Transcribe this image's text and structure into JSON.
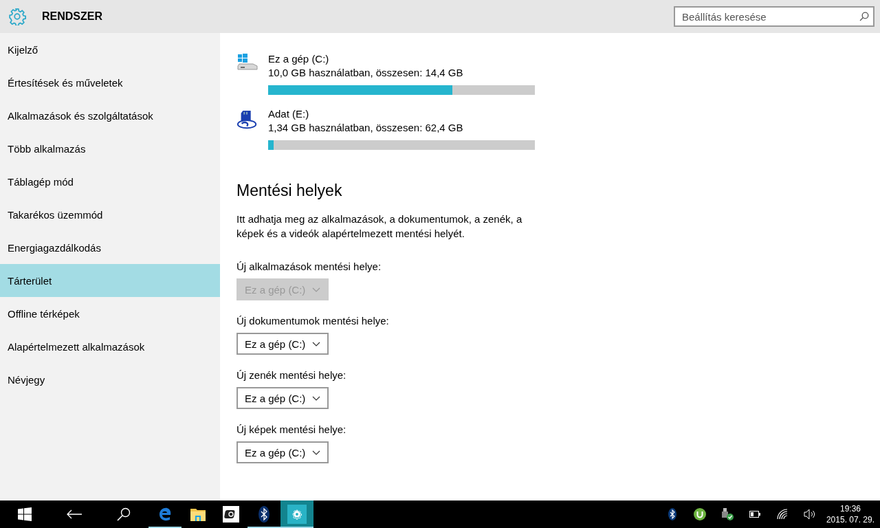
{
  "header": {
    "title": "RENDSZER",
    "search": {
      "placeholder": "Beállítás keresése"
    }
  },
  "sidebar": {
    "items": [
      {
        "label": "Kijelző",
        "selected": false
      },
      {
        "label": "Értesítések és műveletek",
        "selected": false
      },
      {
        "label": "Alkalmazások és szolgáltatások",
        "selected": false
      },
      {
        "label": "Több alkalmazás",
        "selected": false
      },
      {
        "label": "Táblagép mód",
        "selected": false
      },
      {
        "label": "Takarékos üzemmód",
        "selected": false
      },
      {
        "label": "Energiagazdálkodás",
        "selected": false
      },
      {
        "label": "Tárterület",
        "selected": true
      },
      {
        "label": "Offline térképek",
        "selected": false
      },
      {
        "label": "Alapértelmezett alkalmazások",
        "selected": false
      },
      {
        "label": "Névjegy",
        "selected": false
      }
    ]
  },
  "content": {
    "drives": [
      {
        "kind": "system",
        "name": "Ez a gép (C:)",
        "usage": "10,0 GB használatban, összesen: 14,4 GB",
        "level": 0.69
      },
      {
        "kind": "sdcard",
        "name": "Adat (E:)",
        "usage": "1,34 GB használatban, összesen: 62,4 GB",
        "level": 0.02
      }
    ],
    "save_locations": {
      "heading": "Mentési helyek",
      "description": "Itt adhatja meg az alkalmazások, a dokumentumok, a zenék, a képek és a videók alapértelmezett mentési helyét.",
      "settings": [
        {
          "label": "Új alkalmazások mentési helye:",
          "value": "Ez a gép (C:)",
          "disabled": true
        },
        {
          "label": "Új dokumentumok mentési helye:",
          "value": "Ez a gép (C:)",
          "disabled": false
        },
        {
          "label": "Új zenék mentési helye:",
          "value": "Ez a gép (C:)",
          "disabled": false
        },
        {
          "label": "Új képek mentési helye:",
          "value": "Ez a gép (C:)",
          "disabled": false
        }
      ]
    }
  },
  "taskbar": {
    "apps": [
      {
        "kind": "start",
        "running": false,
        "selected": false
      },
      {
        "kind": "back",
        "running": false,
        "selected": false
      },
      {
        "kind": "search",
        "running": false,
        "selected": false
      },
      {
        "kind": "edge",
        "running": true,
        "selected": false
      },
      {
        "kind": "explorer",
        "running": false,
        "selected": false
      },
      {
        "kind": "app",
        "running": false,
        "selected": false
      },
      {
        "kind": "bluetooth",
        "running": true,
        "selected": false
      },
      {
        "kind": "settings",
        "running": true,
        "selected": true
      }
    ],
    "tray": [
      {
        "kind": "bluetooth"
      },
      {
        "kind": "torrent"
      },
      {
        "kind": "usb"
      },
      {
        "kind": "battery"
      },
      {
        "kind": "wifi"
      },
      {
        "kind": "volume"
      }
    ],
    "time": "19:36",
    "date": "2015. 07. 29."
  }
}
